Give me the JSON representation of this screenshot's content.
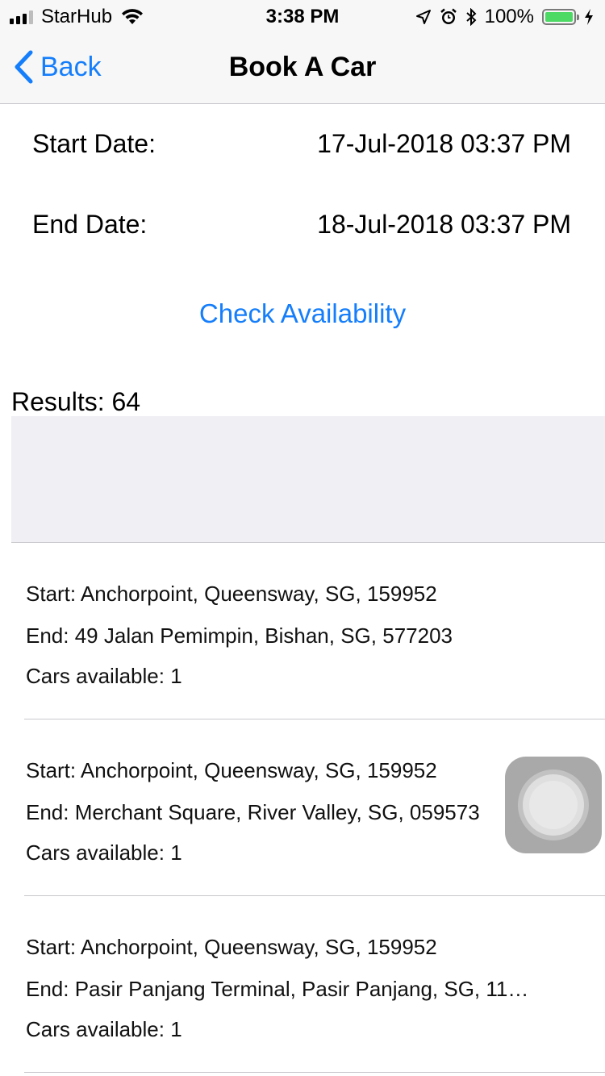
{
  "status_bar": {
    "carrier": "StarHub",
    "time": "3:38 PM",
    "battery": "100%",
    "icons": [
      "signal-icon",
      "wifi-icon",
      "location-icon",
      "alarm-icon",
      "bluetooth-icon",
      "battery-icon",
      "charging-icon"
    ]
  },
  "nav": {
    "back_label": "Back",
    "title": "Book A Car"
  },
  "form": {
    "start_label": "Start Date:",
    "start_value": "17-Jul-2018 03:37 PM",
    "end_label": "End Date:",
    "end_value": "18-Jul-2018 03:37 PM",
    "check_label": "Check Availability"
  },
  "results_label": "Results: 64",
  "results": [
    {
      "start": "Start: Anchorpoint, Queensway, SG, 159952",
      "end": "End: 49 Jalan Pemimpin, Bishan, SG, 577203",
      "cars": "Cars available: 1"
    },
    {
      "start": "Start: Anchorpoint, Queensway, SG, 159952",
      "end": "End: Merchant Square, River Valley, SG, 059573",
      "cars": "Cars available: 1"
    },
    {
      "start": "Start: Anchorpoint, Queensway, SG, 159952",
      "end": "End: Pasir Panjang Terminal, Pasir Panjang, SG, 11…",
      "cars": "Cars available: 1"
    }
  ],
  "colors": {
    "accent": "#157efb",
    "battery": "#4cd964",
    "separator": "#c8c7cc",
    "band": "#efeff4"
  }
}
